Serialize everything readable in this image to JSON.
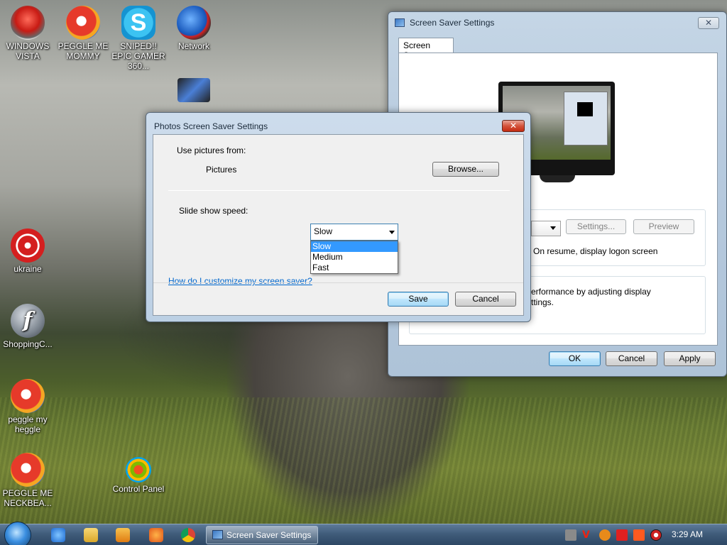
{
  "desktop": {
    "icons": [
      {
        "label": "WINDOWS VISTA",
        "icon": "vista-icon"
      },
      {
        "label": "PEGGLE ME MOMMY",
        "icon": "peggle-icon"
      },
      {
        "label": "SNIPED!! EPIC GAMER 360...",
        "icon": "skype-icon"
      },
      {
        "label": "Network",
        "icon": "network-icon"
      },
      {
        "label": "ukraine",
        "icon": "radiation-icon"
      },
      {
        "label": "ShoppingC...",
        "icon": "flash-icon"
      },
      {
        "label": "peggle my heggle",
        "icon": "peggle-icon"
      },
      {
        "label": "PEGGLE ME NECKBEA...",
        "icon": "peggle-icon"
      },
      {
        "label": "Control Panel",
        "icon": "control-panel-icon"
      }
    ]
  },
  "screen_saver_window": {
    "title": "Screen Saver Settings",
    "tab": "Screen Saver",
    "settings_button": "Settings...",
    "preview_button": "Preview",
    "resume_text": "On resume, display logon screen",
    "power_text_line1": "erformance by adjusting display",
    "power_text_line2": "ttings.",
    "ok_button": "OK",
    "cancel_button": "Cancel",
    "apply_button": "Apply"
  },
  "photos_dialog": {
    "title": "Photos Screen Saver Settings",
    "use_pictures_label": "Use pictures from:",
    "pictures_value": "Pictures",
    "browse_button": "Browse...",
    "speed_label": "Slide show speed:",
    "speed_selected": "Slow",
    "speed_options": [
      "Slow",
      "Medium",
      "Fast"
    ],
    "help_link": "How do I customize my screen saver?",
    "save_button": "Save",
    "cancel_button": "Cancel"
  },
  "taskbar": {
    "active_window": "Screen Saver Settings",
    "clock": "3:29 AM"
  }
}
